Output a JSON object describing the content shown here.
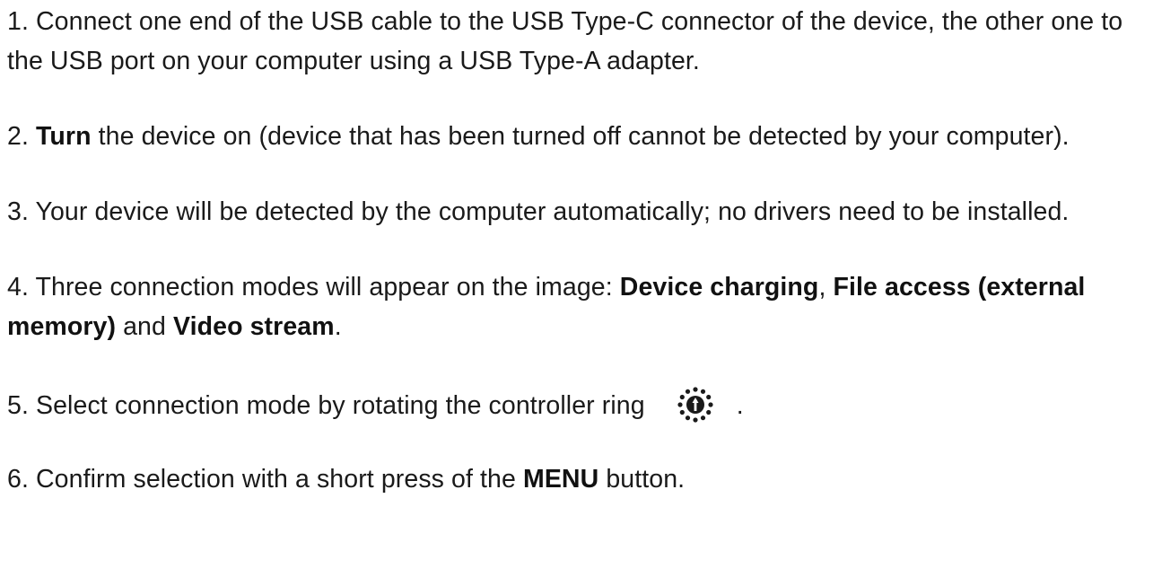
{
  "steps": [
    {
      "number": "1.",
      "text": "Connect one end of the USB cable to the USB Type-C connector of the device, the other one to the USB port on your computer using a USB Type-A adapter."
    },
    {
      "number": "2.",
      "bold": "Turn",
      "text": "the device on (device that has been turned off cannot be detected by your computer)."
    },
    {
      "number": "3.",
      "text": "Your device will be detected by the computer automatically; no drivers need to be installed."
    },
    {
      "number": "4.",
      "text_before": "Three connection modes will appear on the image:",
      "mode1": "Device charging",
      "sep1": ",",
      "mode2": "File access (external memory)",
      "sep2": "and",
      "mode3": "Video stream",
      "end": "."
    },
    {
      "number": "5.",
      "text": "Select connection mode by rotating the controller ring",
      "icon": "controller-ring-icon",
      "end": "."
    },
    {
      "number": "6.",
      "text_before": "Confirm selection with a short press of the",
      "bold": "MENU",
      "text_after": "button."
    }
  ]
}
